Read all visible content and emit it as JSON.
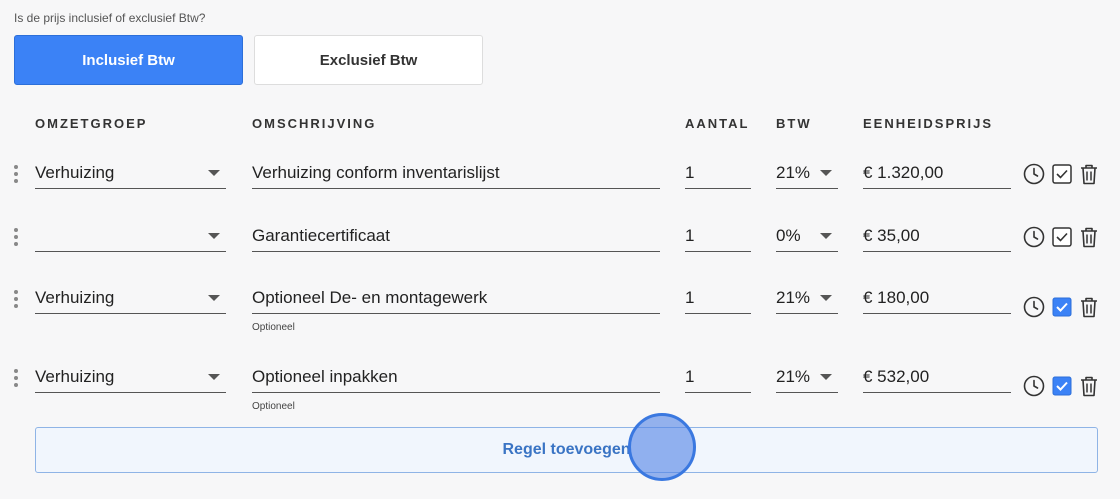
{
  "question": "Is de prijs inclusief of exclusief Btw?",
  "toggle": {
    "inclusive_label": "Inclusief Btw",
    "exclusive_label": "Exclusief Btw",
    "selected": "inclusive"
  },
  "headers": {
    "omzetgroep": "OMZETGROEP",
    "omschrijving": "OMSCHRIJVING",
    "aantal": "AANTAL",
    "btw": "BTW",
    "eenheidsprijs": "EENHEIDSPRIJS"
  },
  "rows": [
    {
      "omzetgroep": "Verhuizing",
      "omschrijving": "Verhuizing conform inventarislijst",
      "aantal": "1",
      "btw": "21%",
      "prijs": "€ 1.320,00",
      "optional": false,
      "sub_label": ""
    },
    {
      "omzetgroep": "",
      "omschrijving": "Garantiecertificaat",
      "aantal": "1",
      "btw": "0%",
      "prijs": "€ 35,00",
      "optional": false,
      "sub_label": ""
    },
    {
      "omzetgroep": "Verhuizing",
      "omschrijving": "Optioneel De- en montagewerk",
      "aantal": "1",
      "btw": "21%",
      "prijs": "€ 180,00",
      "optional": true,
      "sub_label": "Optioneel"
    },
    {
      "omzetgroep": "Verhuizing",
      "omschrijving": "Optioneel inpakken",
      "aantal": "1",
      "btw": "21%",
      "prijs": "€ 532,00",
      "optional": true,
      "sub_label": "Optioneel"
    }
  ],
  "icons": {
    "clock": "clock-icon",
    "checkbox": "checkbox-icon",
    "delete": "trash-icon",
    "drag": "drag-handle-icon"
  },
  "add_button_label": "Regel toevoegen",
  "colors": {
    "accent": "#3b82f6",
    "add_button_text": "#3a74c4"
  }
}
